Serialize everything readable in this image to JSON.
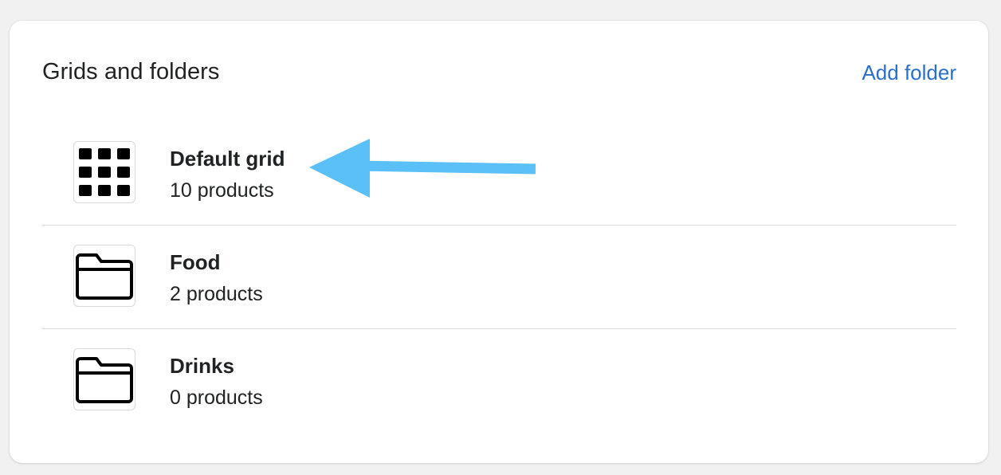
{
  "card": {
    "title": "Grids and folders",
    "add_folder_label": "Add folder"
  },
  "items": [
    {
      "name": "Default grid",
      "count": "10 products",
      "icon": "grid-icon"
    },
    {
      "name": "Food",
      "count": "2 products",
      "icon": "folder-icon"
    },
    {
      "name": "Drinks",
      "count": "0 products",
      "icon": "folder-icon"
    }
  ],
  "annotation": {
    "arrow_color": "#5bc0f8",
    "arrow_target": "Default grid"
  },
  "colors": {
    "link": "#2c6ecb",
    "text": "#202223",
    "divider": "#dcdcdc"
  }
}
